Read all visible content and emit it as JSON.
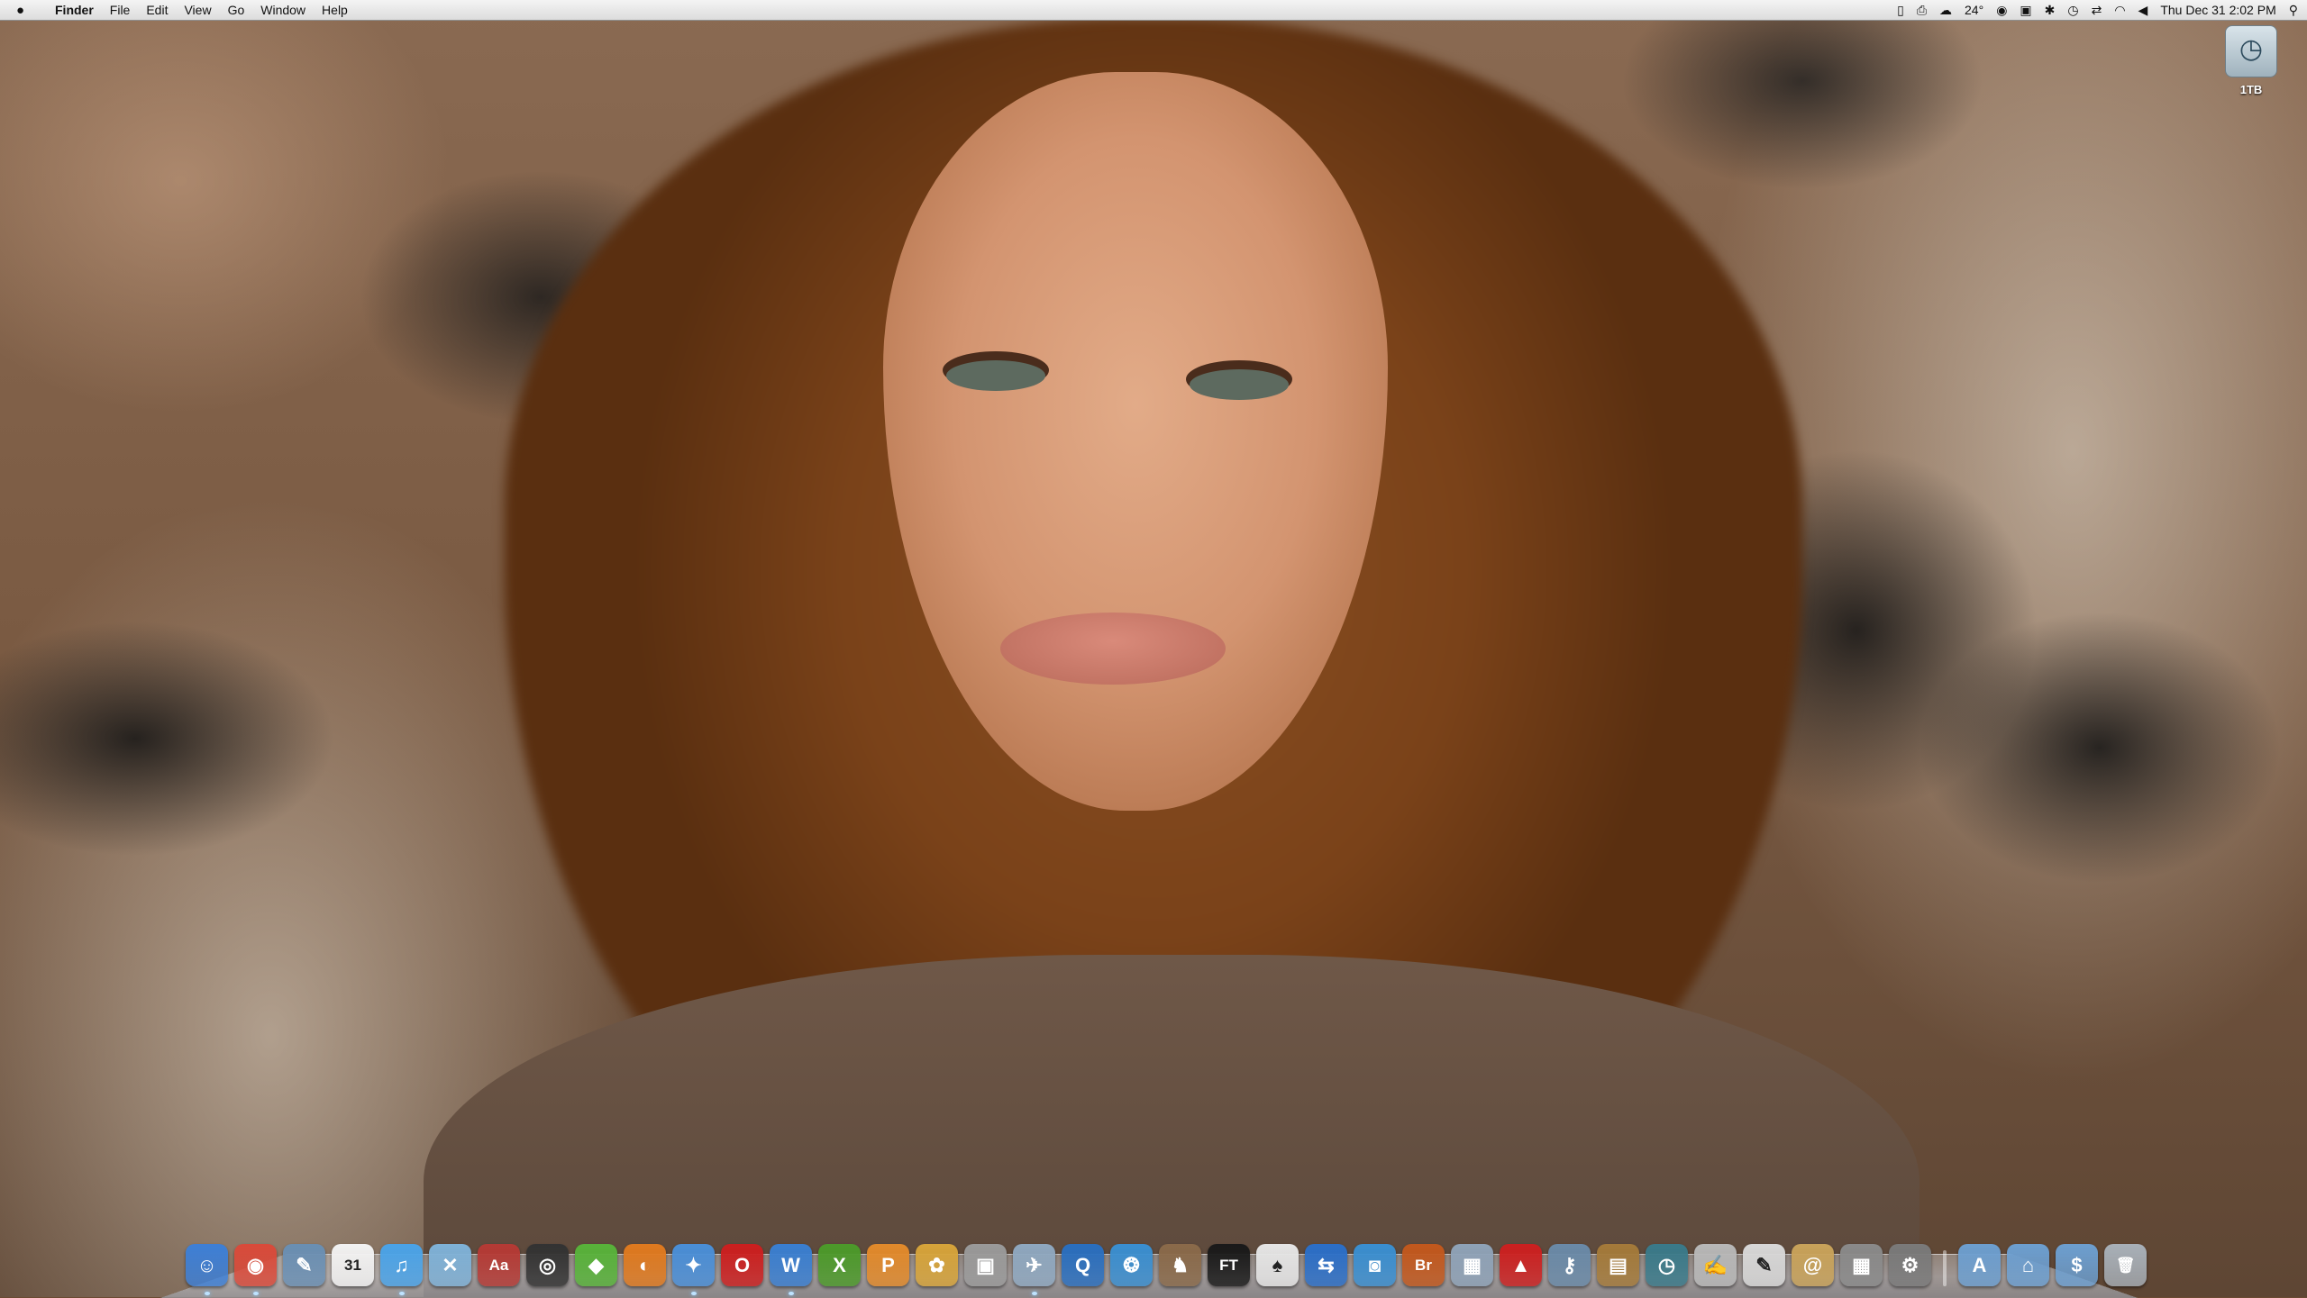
{
  "menubar": {
    "apple_icon": "apple-icon",
    "items": [
      "Finder",
      "File",
      "Edit",
      "View",
      "Go",
      "Window",
      "Help"
    ],
    "status": {
      "temperature": "24°",
      "datetime": "Thu Dec 31  2:02 PM"
    }
  },
  "desktop": {
    "drive_label": "1TB"
  },
  "dock": {
    "items": [
      {
        "icon": "finder-icon",
        "glyph": "☺",
        "color": "#3d7fd6"
      },
      {
        "icon": "chrome-icon",
        "glyph": "◉",
        "color": "#d94a3a"
      },
      {
        "icon": "preview-icon",
        "glyph": "✎",
        "color": "#6a8fb3"
      },
      {
        "icon": "ical-icon",
        "glyph": "31",
        "color": "#f2f2f2"
      },
      {
        "icon": "itunes-icon",
        "glyph": "♫",
        "color": "#4aa3e8"
      },
      {
        "icon": "xcode-icon",
        "glyph": "✕",
        "color": "#7fb2d8"
      },
      {
        "icon": "dictionary-icon",
        "glyph": "Aa",
        "color": "#b53a35"
      },
      {
        "icon": "aperture-icon",
        "glyph": "◎",
        "color": "#333333"
      },
      {
        "icon": "utorrent-icon",
        "glyph": "◆",
        "color": "#58b33a"
      },
      {
        "icon": "firefox-icon",
        "glyph": "◐",
        "color": "#e07a1f"
      },
      {
        "icon": "safari-icon",
        "glyph": "✦",
        "color": "#4a8fd8"
      },
      {
        "icon": "opera-icon",
        "glyph": "O",
        "color": "#cc1f1f"
      },
      {
        "icon": "word-icon",
        "glyph": "W",
        "color": "#3a7fd1"
      },
      {
        "icon": "excel-icon",
        "glyph": "X",
        "color": "#4c9a2a"
      },
      {
        "icon": "powerpoint-icon",
        "glyph": "P",
        "color": "#e28a2b"
      },
      {
        "icon": "adium-icon",
        "glyph": "✿",
        "color": "#d7a43a"
      },
      {
        "icon": "dvd-player-icon",
        "glyph": "▣",
        "color": "#9a9a9a"
      },
      {
        "icon": "mail-icon",
        "glyph": "✈",
        "color": "#8fa8c0"
      },
      {
        "icon": "quicktime-icon",
        "glyph": "Q",
        "color": "#2a6fbf"
      },
      {
        "icon": "spiral-icon",
        "glyph": "❂",
        "color": "#3a8fd1"
      },
      {
        "icon": "gimp-icon",
        "glyph": "♞",
        "color": "#8a6a4a"
      },
      {
        "icon": "full-tilt-icon",
        "glyph": "FT",
        "color": "#1a1a1a"
      },
      {
        "icon": "poker-cards-icon",
        "glyph": "♠",
        "color": "#e6e6e6"
      },
      {
        "icon": "teamviewer-icon",
        "glyph": "⇆",
        "color": "#2b6fc8"
      },
      {
        "icon": "photo-booth-icon",
        "glyph": "◙",
        "color": "#3a8fd1"
      },
      {
        "icon": "bridge-icon",
        "glyph": "Br",
        "color": "#c2581d"
      },
      {
        "icon": "iphoto-icon",
        "glyph": "▦",
        "color": "#8fa3b8"
      },
      {
        "icon": "stapler-icon",
        "glyph": "▲",
        "color": "#cc2020"
      },
      {
        "icon": "keychain-icon",
        "glyph": "⚷",
        "color": "#6a8aa8"
      },
      {
        "icon": "preview-photos-icon",
        "glyph": "▤",
        "color": "#a47a3a"
      },
      {
        "icon": "time-machine-icon",
        "glyph": "◷",
        "color": "#3a7a8a"
      },
      {
        "icon": "script-editor-icon",
        "glyph": "✍",
        "color": "#b8b8b8"
      },
      {
        "icon": "textedit-icon",
        "glyph": "✎",
        "color": "#d8d8d8"
      },
      {
        "icon": "address-book-icon",
        "glyph": "@",
        "color": "#c9a35a"
      },
      {
        "icon": "calculator-icon",
        "glyph": "▦",
        "color": "#8a8a8a"
      },
      {
        "icon": "system-preferences-icon",
        "glyph": "⚙",
        "color": "#7a7a7a"
      },
      {
        "icon": "separator",
        "glyph": "",
        "color": ""
      },
      {
        "icon": "applications-folder-icon",
        "glyph": "A",
        "color": "#6d9fd0"
      },
      {
        "icon": "home-folder-icon",
        "glyph": "⌂",
        "color": "#6d9fd0"
      },
      {
        "icon": "documents-folder-icon",
        "glyph": "$",
        "color": "#6d9fd0"
      },
      {
        "icon": "trash-icon",
        "glyph": "🗑",
        "color": "#a8b0b8"
      }
    ]
  }
}
